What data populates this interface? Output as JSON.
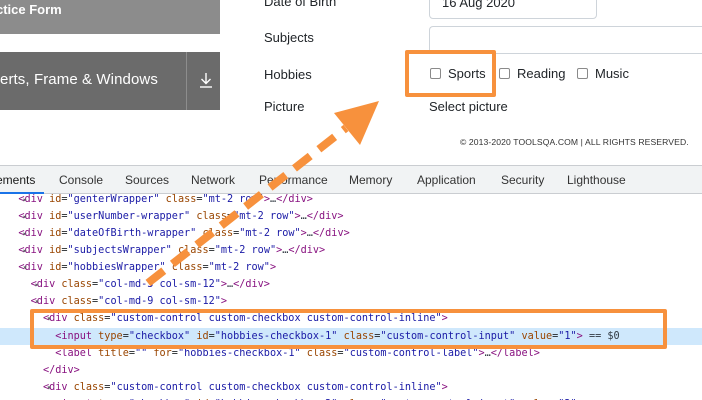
{
  "sidebar": {
    "practice_form": "ctice Form",
    "elements_group": "erts, Frame & Windows"
  },
  "form": {
    "dob_label": "Date of Birth",
    "dob_value": "16 Aug 2020",
    "subjects_label": "Subjects",
    "hobbies_label": "Hobbies",
    "hobbies": [
      {
        "label": "Sports",
        "checked": false
      },
      {
        "label": "Reading",
        "checked": false
      },
      {
        "label": "Music",
        "checked": false
      }
    ],
    "picture_label": "Picture",
    "picture_button": "Select picture"
  },
  "footer": {
    "copyright": "© 2013-2020 TOOLSQA.COM | ALL RIGHTS RESERVED."
  },
  "devtools": {
    "tabs": [
      "ements",
      "Console",
      "Sources",
      "Network",
      "Performance",
      "Memory",
      "Application",
      "Security",
      "Lighthouse"
    ],
    "active_tab": "ements"
  },
  "colors": {
    "highlight": "#f7913d",
    "selected_line": "#cfe8fc",
    "tag": "#881280",
    "attr": "#994500",
    "value": "#1a1aa6"
  },
  "icons": {
    "download": "download-icon"
  }
}
